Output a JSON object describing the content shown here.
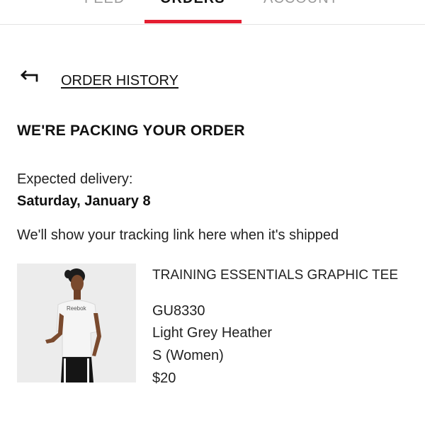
{
  "tabs": [
    {
      "label": "FEED",
      "active": false
    },
    {
      "label": "ORDERS",
      "active": true
    },
    {
      "label": "ACCOUNT",
      "active": false
    }
  ],
  "accent_color": "#e41e31",
  "back_link": {
    "icon": "return-arrow-icon",
    "label": "ORDER HISTORY"
  },
  "order": {
    "status_heading": "WE'RE PACKING YOUR ORDER",
    "delivery_label": "Expected delivery:",
    "delivery_date": "Saturday, January 8",
    "tracking_note": "We'll show your tracking link here when it's shipped"
  },
  "product": {
    "name": "TRAINING ESSENTIALS GRAPHIC TEE",
    "sku": "GU8330",
    "color": "Light Grey Heather",
    "size": "S (Women)",
    "price": "$20",
    "image_logo_text": "Reebok"
  }
}
